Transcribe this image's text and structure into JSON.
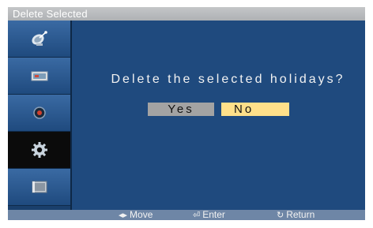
{
  "window": {
    "title": "Delete Selected"
  },
  "dialog": {
    "message": "Delete the selected holidays?",
    "yes_label": "Yes",
    "no_label": "No",
    "selected_button": "No"
  },
  "sidebar": {
    "items": [
      {
        "icon": "satellite-dish-icon",
        "active": false
      },
      {
        "icon": "picture-icon",
        "active": false
      },
      {
        "icon": "sound-icon",
        "active": false
      },
      {
        "icon": "gear-icon",
        "active": true
      },
      {
        "icon": "input-source-icon",
        "active": false
      }
    ]
  },
  "footer": {
    "move_label": "Move",
    "enter_label": "Enter",
    "return_label": "Return",
    "move_icon": "left-right-arrow-icon",
    "enter_icon": "enter-icon",
    "return_icon": "return-icon"
  },
  "colors": {
    "panel": "#1f4a7e",
    "highlight": "#ffe08a",
    "button_idle": "#a3a3a3",
    "footer": "#6e86a6"
  }
}
